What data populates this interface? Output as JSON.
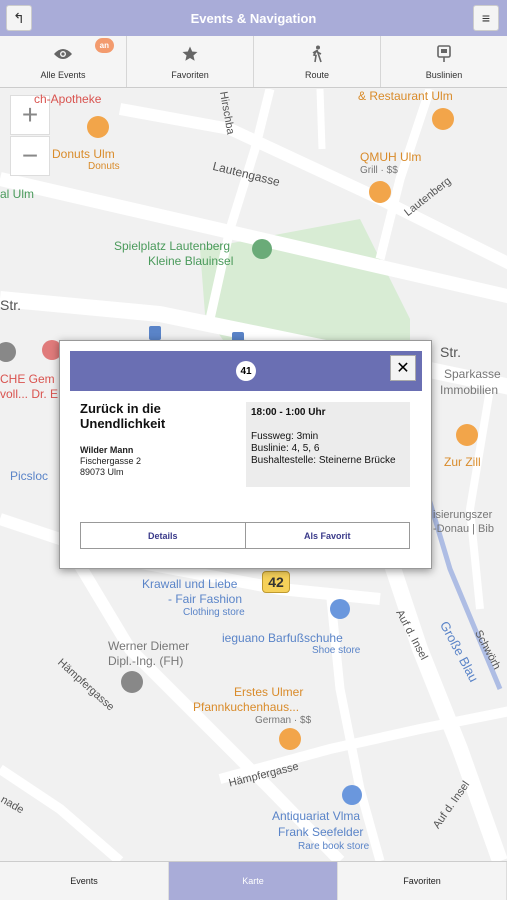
{
  "header": {
    "title": "Events & Navigation",
    "back_icon": "↰",
    "menu_icon": "≡"
  },
  "tabs": [
    {
      "label": "Alle Events",
      "icon": "eye-icon",
      "badge": "an"
    },
    {
      "label": "Favoriten",
      "icon": "star-icon"
    },
    {
      "label": "Route",
      "icon": "walking-person-icon"
    },
    {
      "label": "Buslinien",
      "icon": "bus-stop-icon"
    }
  ],
  "map": {
    "zoom_in": "+",
    "zoom_out": "−",
    "labels": {
      "apotheke": "ch-Apotheke",
      "restaurant": "& Restaurant Ulm",
      "donuts": "Donuts Ulm",
      "donuts_sub": "Donuts",
      "qmuh": "QMUH Ulm",
      "qmuh_sub": "Grill · $$",
      "hirschbad": "Hirschba",
      "lautengasse": "Lautengasse",
      "lautenberg": "Lautenberg",
      "al_ulm": "al Ulm",
      "spielplatz": "Spielplatz Lautenberg",
      "blauinsel": "Kleine Blauinsel",
      "str_left": "Str.",
      "str_right": "Str.",
      "cheg": "CHE Gem",
      "dr": "voll... Dr. E",
      "sparkasse": "Sparkasse",
      "immobilien": "Immobilien",
      "picsloc": "Picsloc",
      "zoll": "Zur Zill",
      "isierung": "isierungszer",
      "donau": "-Donau | Bib",
      "krawall": "Krawall und Liebe",
      "fair": "- Fair Fashion",
      "clothing": "Clothing store",
      "ieguano": "ieguano Barfußschuhe",
      "shoe": "Shoe store",
      "werner1": "Werner Diemer",
      "werner2": "Dipl.-Ing. (FH)",
      "hampfergasse1": "Hämpfergasse",
      "hampfergasse2": "Hämpfergasse",
      "erstes1": "Erstes Ulmer",
      "erstes2": "Pfannkuchenhaus...",
      "german": "German · $$",
      "insel1": "Auf d. Insel",
      "insel2": "Auf d. Insel",
      "grosse": "Große Blau",
      "schwoerh": "Schwörh",
      "nade": "nade",
      "antiquariat": "Antiquariat Vlma",
      "frank": "Frank Seefelder",
      "rarebook": "Rare book store"
    },
    "marker_42": "42"
  },
  "popup": {
    "number": "41",
    "close": "✕",
    "title": "Zurück in die Unendlichkeit",
    "venue_name": "Wilder Mann",
    "venue_street": "Fischergasse 2",
    "venue_city": "89073 Ulm",
    "time": "18:00 - 1:00 Uhr",
    "fussweg": "Fussweg: 3min",
    "buslinie": "Buslinie: 4, 5, 6",
    "bushaltestelle": "Bushaltestelle: Steinerne Brücke",
    "details_label": "Details",
    "favorit_label": "Als Favorit"
  },
  "bottom_nav": [
    {
      "label": "Events",
      "active": false
    },
    {
      "label": "Karte",
      "active": true
    },
    {
      "label": "Favoriten",
      "active": false
    }
  ],
  "colors": {
    "header_bg": "#a9acd8",
    "popup_header": "#6a6fb3",
    "badge": "#f39b6e",
    "marker": "#f6d15a"
  }
}
